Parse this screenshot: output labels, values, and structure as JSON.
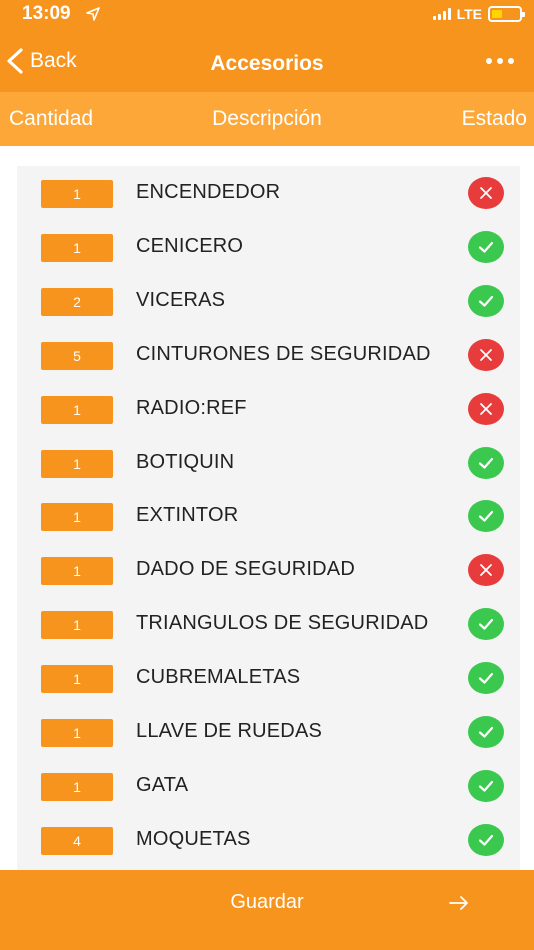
{
  "status_bar": {
    "time": "13:09",
    "network": "LTE"
  },
  "nav": {
    "back_label": "Back",
    "title": "Accesorios"
  },
  "columns": {
    "quantity": "Cantidad",
    "description": "Descripción",
    "status": "Estado"
  },
  "items": [
    {
      "qty": "1",
      "description": "ENCENDEDOR",
      "status": "missing"
    },
    {
      "qty": "1",
      "description": "CENICERO",
      "status": "ok"
    },
    {
      "qty": "2",
      "description": "VICERAS",
      "status": "ok"
    },
    {
      "qty": "5",
      "description": "CINTURONES DE SEGURIDAD",
      "status": "missing"
    },
    {
      "qty": "1",
      "description": "RADIO:REF",
      "status": "missing"
    },
    {
      "qty": "1",
      "description": "BOTIQUIN",
      "status": "ok"
    },
    {
      "qty": "1",
      "description": "EXTINTOR",
      "status": "ok"
    },
    {
      "qty": "1",
      "description": "DADO DE SEGURIDAD",
      "status": "missing"
    },
    {
      "qty": "1",
      "description": "TRIANGULOS DE SEGURIDAD",
      "status": "ok"
    },
    {
      "qty": "1",
      "description": "CUBREMALETAS",
      "status": "ok"
    },
    {
      "qty": "1",
      "description": "LLAVE DE RUEDAS",
      "status": "ok"
    },
    {
      "qty": "1",
      "description": "GATA",
      "status": "ok"
    },
    {
      "qty": "4",
      "description": "MOQUETAS",
      "status": "ok"
    }
  ],
  "footer": {
    "save_label": "Guardar"
  },
  "colors": {
    "primary": "#f7941d",
    "header_row": "#fca738",
    "ok": "#3bc84f",
    "missing": "#e83b3b",
    "list_bg": "#f4f4f4"
  },
  "icons": {
    "back": "chevron-left-icon",
    "more": "more-horizontal-icon",
    "ok": "check-icon",
    "missing": "close-icon",
    "save": "arrow-right-icon",
    "location": "location-arrow-icon",
    "signal": "signal-icon",
    "battery": "battery-icon"
  }
}
